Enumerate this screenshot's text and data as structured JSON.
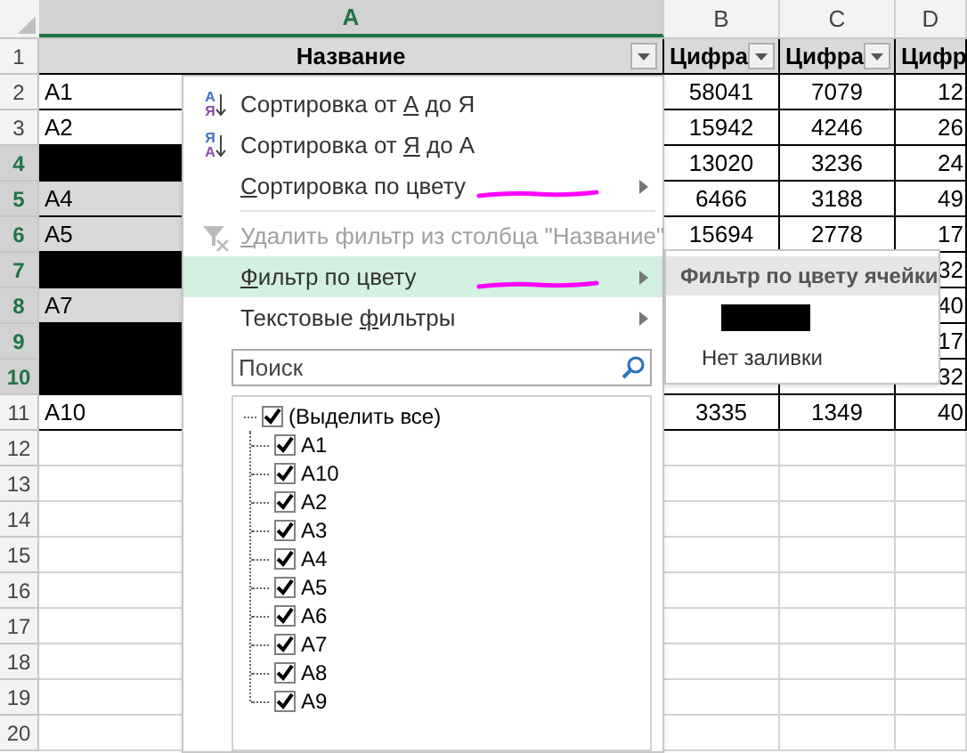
{
  "columns": [
    {
      "letter": "A",
      "selected": true
    },
    {
      "letter": "B",
      "selected": false
    },
    {
      "letter": "C",
      "selected": false
    },
    {
      "letter": "D",
      "selected": false
    }
  ],
  "rows": [
    {
      "number": "1",
      "selected": false,
      "kind": "header",
      "cells": [
        {
          "text": "Название",
          "filter_button": true
        },
        {
          "text": "Цифра",
          "filter_button": true
        },
        {
          "text": "Цифра",
          "filter_button": true
        },
        {
          "text": "Цифр",
          "filter_button": false
        }
      ]
    },
    {
      "number": "2",
      "selected": false,
      "cells": [
        {
          "text": "A1"
        },
        {
          "text": "58041"
        },
        {
          "text": "7079"
        },
        {
          "text": "12"
        }
      ]
    },
    {
      "number": "3",
      "selected": false,
      "cells": [
        {
          "text": "A2"
        },
        {
          "text": "15942"
        },
        {
          "text": "4246"
        },
        {
          "text": "26"
        }
      ]
    },
    {
      "number": "4",
      "selected": true,
      "cells": [
        {
          "color": "#000000"
        },
        {
          "text": "13020"
        },
        {
          "text": "3236"
        },
        {
          "text": "24"
        }
      ]
    },
    {
      "number": "5",
      "selected": true,
      "cells": [
        {
          "text": "A4"
        },
        {
          "text": "6466"
        },
        {
          "text": "3188"
        },
        {
          "text": "49"
        }
      ]
    },
    {
      "number": "6",
      "selected": true,
      "cells": [
        {
          "text": "A5"
        },
        {
          "text": "15694"
        },
        {
          "text": "2778"
        },
        {
          "text": "17"
        }
      ]
    },
    {
      "number": "7",
      "selected": true,
      "cells": [
        {
          "color": "#000000"
        },
        {},
        {},
        {
          "text": "32"
        }
      ]
    },
    {
      "number": "8",
      "selected": true,
      "cells": [
        {
          "text": "A7"
        },
        {},
        {},
        {
          "text": "40"
        }
      ]
    },
    {
      "number": "9",
      "selected": true,
      "cells": [
        {
          "color": "#000000"
        },
        {},
        {},
        {
          "text": "17"
        }
      ]
    },
    {
      "number": "10",
      "selected": true,
      "cells": [
        {
          "color": "#000000"
        },
        {},
        {},
        {
          "text": "32"
        }
      ]
    },
    {
      "number": "11",
      "selected": false,
      "cells": [
        {
          "text": "A10"
        },
        {
          "text": "3335"
        },
        {
          "text": "1349"
        },
        {
          "text": "40"
        }
      ]
    },
    {
      "number": "12",
      "selected": false,
      "kind": "empty"
    },
    {
      "number": "13",
      "selected": false,
      "kind": "empty"
    },
    {
      "number": "14",
      "selected": false,
      "kind": "empty"
    },
    {
      "number": "15",
      "selected": false,
      "kind": "empty"
    },
    {
      "number": "16",
      "selected": false,
      "kind": "empty"
    },
    {
      "number": "17",
      "selected": false,
      "kind": "empty"
    },
    {
      "number": "18",
      "selected": false,
      "kind": "empty"
    },
    {
      "number": "19",
      "selected": false,
      "kind": "empty"
    },
    {
      "number": "20",
      "selected": false,
      "kind": "empty"
    }
  ],
  "filter_menu": {
    "items": [
      {
        "kind": "sort",
        "icon_top": "А",
        "icon_bottom": "Я",
        "label": {
          "pre": "Сортировка от ",
          "key": "А",
          "post": " до Я"
        },
        "disabled": false,
        "selected": false
      },
      {
        "kind": "sort",
        "icon_top": "Я",
        "icon_bottom": "А",
        "label": {
          "pre": "Сортировка от ",
          "key": "Я",
          "post": " до А"
        },
        "disabled": false,
        "selected": false
      },
      {
        "kind": "item",
        "label": {
          "key": "С",
          "post": "ортировка по цвету"
        },
        "disabled": false,
        "selected": false,
        "submenu": true,
        "annotated": true
      },
      {
        "kind": "separator"
      },
      {
        "kind": "clear",
        "label": {
          "key": "У",
          "post": "далить фильтр из столбца \"Название\""
        },
        "disabled": true,
        "selected": false
      },
      {
        "kind": "item",
        "label": {
          "key": "Ф",
          "post": "ильтр по цвету"
        },
        "disabled": false,
        "selected": true,
        "submenu": true,
        "annotated": true
      },
      {
        "kind": "item",
        "label": {
          "pre": "Текстовые ",
          "key": "ф",
          "post": "ильтры"
        },
        "disabled": false,
        "selected": false,
        "submenu": true
      }
    ],
    "search": {
      "placeholder": "Поиск"
    },
    "values": [
      {
        "label": "(Выделить все)",
        "checked": true,
        "children": [
          {
            "label": "A1",
            "checked": true
          },
          {
            "label": "A10",
            "checked": true
          },
          {
            "label": "A2",
            "checked": true
          },
          {
            "label": "A3",
            "checked": true
          },
          {
            "label": "A4",
            "checked": true
          },
          {
            "label": "A5",
            "checked": true
          },
          {
            "label": "A6",
            "checked": true
          },
          {
            "label": "A7",
            "checked": true
          },
          {
            "label": "A8",
            "checked": true
          },
          {
            "label": "A9",
            "checked": true
          }
        ]
      }
    ]
  },
  "color_submenu": {
    "title": "Фильтр по цвету ячейки",
    "swatches": [
      {
        "color": "#000000"
      }
    ],
    "no_fill": "Нет заливки"
  }
}
